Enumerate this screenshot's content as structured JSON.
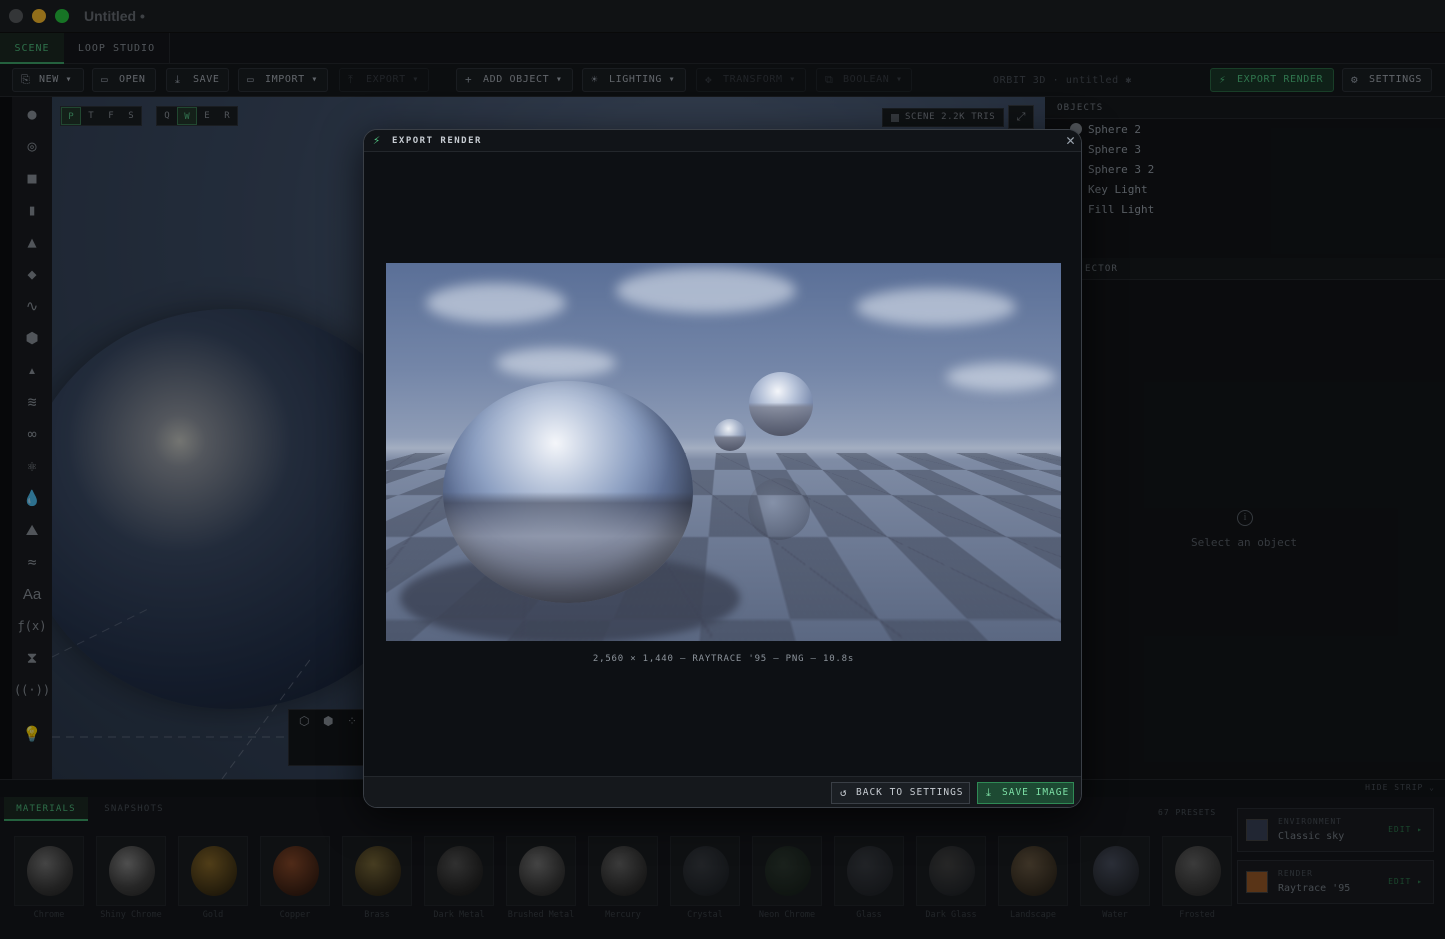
{
  "window": {
    "title": "Untitled •"
  },
  "tabs": [
    {
      "label": "SCENE"
    },
    {
      "label": "LOOP STUDIO"
    }
  ],
  "toolbar": {
    "new": "NEW",
    "open": "OPEN",
    "save": "SAVE",
    "import": "IMPORT",
    "export": "EXPORT",
    "add_object": "ADD OBJECT",
    "lighting": "LIGHTING",
    "transform": "TRANSFORM",
    "boolean": "BOOLEAN",
    "project_label": "ORBIT 3D · untitled ✱",
    "export_render": "EXPORT RENDER",
    "settings": "SETTINGS"
  },
  "viewport": {
    "view_modes": [
      "P",
      "T",
      "F",
      "S"
    ],
    "tool_modes": [
      "Q",
      "W",
      "E",
      "R"
    ],
    "scene_badge": "SCENE 2.2K TRIS"
  },
  "objects": {
    "header": "OBJECTS",
    "items": [
      "Sphere 2",
      "Sphere 3",
      "Sphere 3 2",
      "Key Light",
      "Fill Light"
    ]
  },
  "inspector": {
    "header": "ECTOR",
    "empty": "Select an object"
  },
  "strip": {
    "hide": "HIDE STRIP"
  },
  "bottom": {
    "tabs": [
      "MATERIALS",
      "SNAPSHOTS"
    ],
    "presets_count": "67 PRESETS",
    "materials": [
      "Chrome",
      "Shiny Chrome",
      "Gold",
      "Copper",
      "Brass",
      "Dark Metal",
      "Brushed Metal",
      "Mercury",
      "Crystal",
      "Neon Chrome",
      "Glass",
      "Dark Glass",
      "Landscape",
      "Water",
      "Frosted"
    ],
    "environment": {
      "key": "ENVIRONMENT",
      "value": "Classic sky",
      "edit": "EDIT ▸",
      "color": "#3a4258"
    },
    "render": {
      "key": "RENDER",
      "value": "Raytrace '95",
      "edit": "EDIT ▸",
      "color": "#9a5a28"
    }
  },
  "modal": {
    "title": "EXPORT RENDER",
    "caption": "2,560 × 1,440 — RAYTRACE '95 — PNG — 10.8s",
    "back": "BACK TO SETTINGS",
    "save": "SAVE IMAGE"
  },
  "colors": {
    "accent": "#4fbf7e",
    "background": "#0d0f12"
  }
}
